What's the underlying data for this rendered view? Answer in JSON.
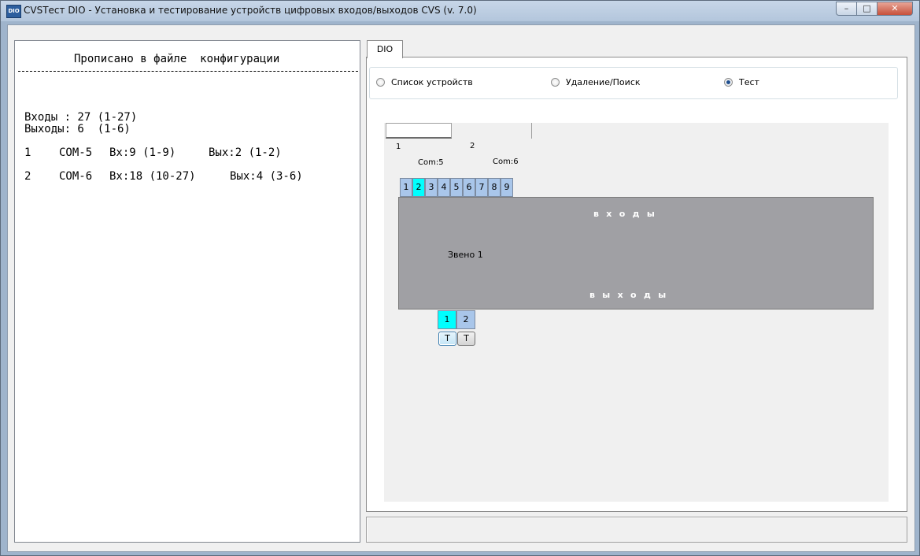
{
  "window": {
    "title": "CVSТест DIO - Установка и тестирование устройств цифровых входов/выходов  CVS (v. 7.0)",
    "icon_label": "DIO",
    "controls": {
      "minimize": "–",
      "maximize": "□",
      "close": "✕"
    }
  },
  "config": {
    "title": "Прописано в файле  конфигурации",
    "inputs_line": "Входы : 27 (1-27)",
    "outputs_line": "Выходы: 6  (1-6)",
    "devices": [
      {
        "num": "1",
        "port": "COM-5",
        "inputs": "Вх:9 (1-9)",
        "outputs": "Вых:2 (1-2)"
      },
      {
        "num": "2",
        "port": "COM-6",
        "inputs": "Вх:18 (10-27)",
        "outputs": "Вых:4 (3-6)"
      }
    ]
  },
  "main_tab": {
    "label": "DIO"
  },
  "modes": [
    {
      "label": "Список устройств",
      "checked": false
    },
    {
      "label": "Удаление/Поиск",
      "checked": false
    },
    {
      "label": "Тест",
      "checked": true
    }
  ],
  "device_tabs": [
    {
      "num": "1",
      "port": "Com:5",
      "active": true
    },
    {
      "num": "2",
      "port": "Com:6",
      "active": false
    }
  ],
  "link": {
    "name": "Звено 1",
    "inputs_label": "входы",
    "outputs_label": "выходы",
    "inputs": [
      {
        "label": "1",
        "on": false
      },
      {
        "label": "2",
        "on": true
      },
      {
        "label": "3",
        "on": false
      },
      {
        "label": "4",
        "on": false
      },
      {
        "label": "5",
        "on": false
      },
      {
        "label": "6",
        "on": false
      },
      {
        "label": "7",
        "on": false
      },
      {
        "label": "8",
        "on": false
      },
      {
        "label": "9",
        "on": false
      }
    ],
    "outputs": [
      {
        "label": "1",
        "on": true
      },
      {
        "label": "2",
        "on": false
      }
    ],
    "test_button_label": "T"
  },
  "colors": {
    "input_off": "#a9c6ea",
    "input_on": "#00ffff",
    "link_block": "#a0a0a4"
  }
}
